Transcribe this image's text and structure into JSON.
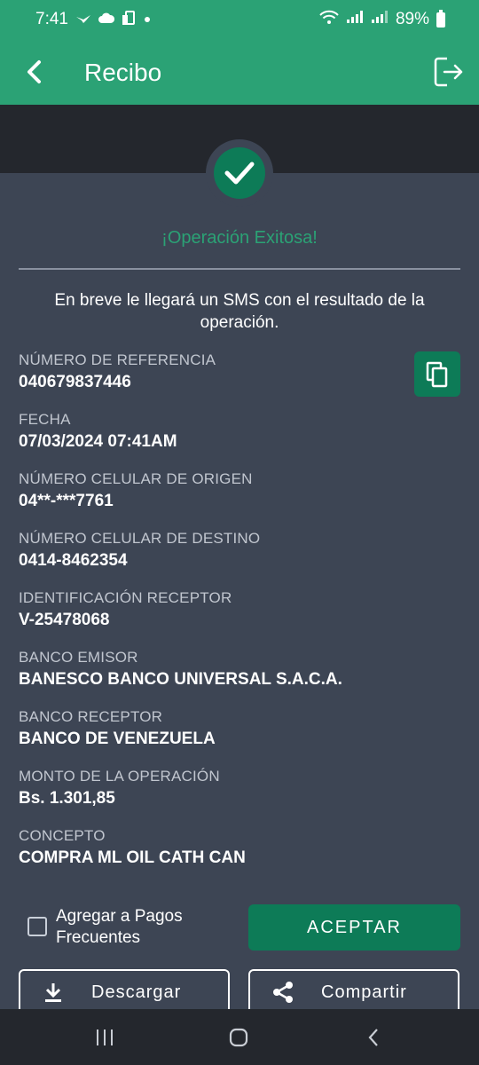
{
  "status_bar": {
    "time": "7:41",
    "left_icons": [
      "bird-icon",
      "cloud-icon",
      "phone-icon",
      "dot-icon"
    ],
    "battery": "89%"
  },
  "app_bar": {
    "title": "Recibo"
  },
  "receipt": {
    "success_title": "¡Operación Exitosa!",
    "sms_message": "En breve le llegará un SMS con el resultado de la operación.",
    "fields": [
      {
        "label": "NÚMERO DE REFERENCIA",
        "value": "040679837446"
      },
      {
        "label": "FECHA",
        "value": "07/03/2024 07:41AM"
      },
      {
        "label": "NÚMERO CELULAR DE ORIGEN",
        "value": "04**-***7761"
      },
      {
        "label": "NÚMERO CELULAR DE DESTINO",
        "value": "0414-8462354"
      },
      {
        "label": "IDENTIFICACIÓN RECEPTOR",
        "value": "V-25478068"
      },
      {
        "label": "BANCO EMISOR",
        "value": "BANESCO BANCO UNIVERSAL S.A.C.A."
      },
      {
        "label": "BANCO RECEPTOR",
        "value": "BANCO DE VENEZUELA"
      },
      {
        "label": "MONTO DE LA OPERACIÓN",
        "value": "Bs. 1.301,85"
      },
      {
        "label": "CONCEPTO",
        "value": "COMPRA ML OIL CATH CAN"
      }
    ]
  },
  "actions": {
    "frequent_checkbox_label": "Agregar a Pagos Frecuentes",
    "frequent_checked": false,
    "accept_label": "ACEPTAR",
    "download_label": "Descargar",
    "share_label": "Compartir"
  },
  "colors": {
    "primary": "#2ba275",
    "button": "#0d7b57",
    "background": "#3d4554",
    "dark": "#24272d"
  }
}
